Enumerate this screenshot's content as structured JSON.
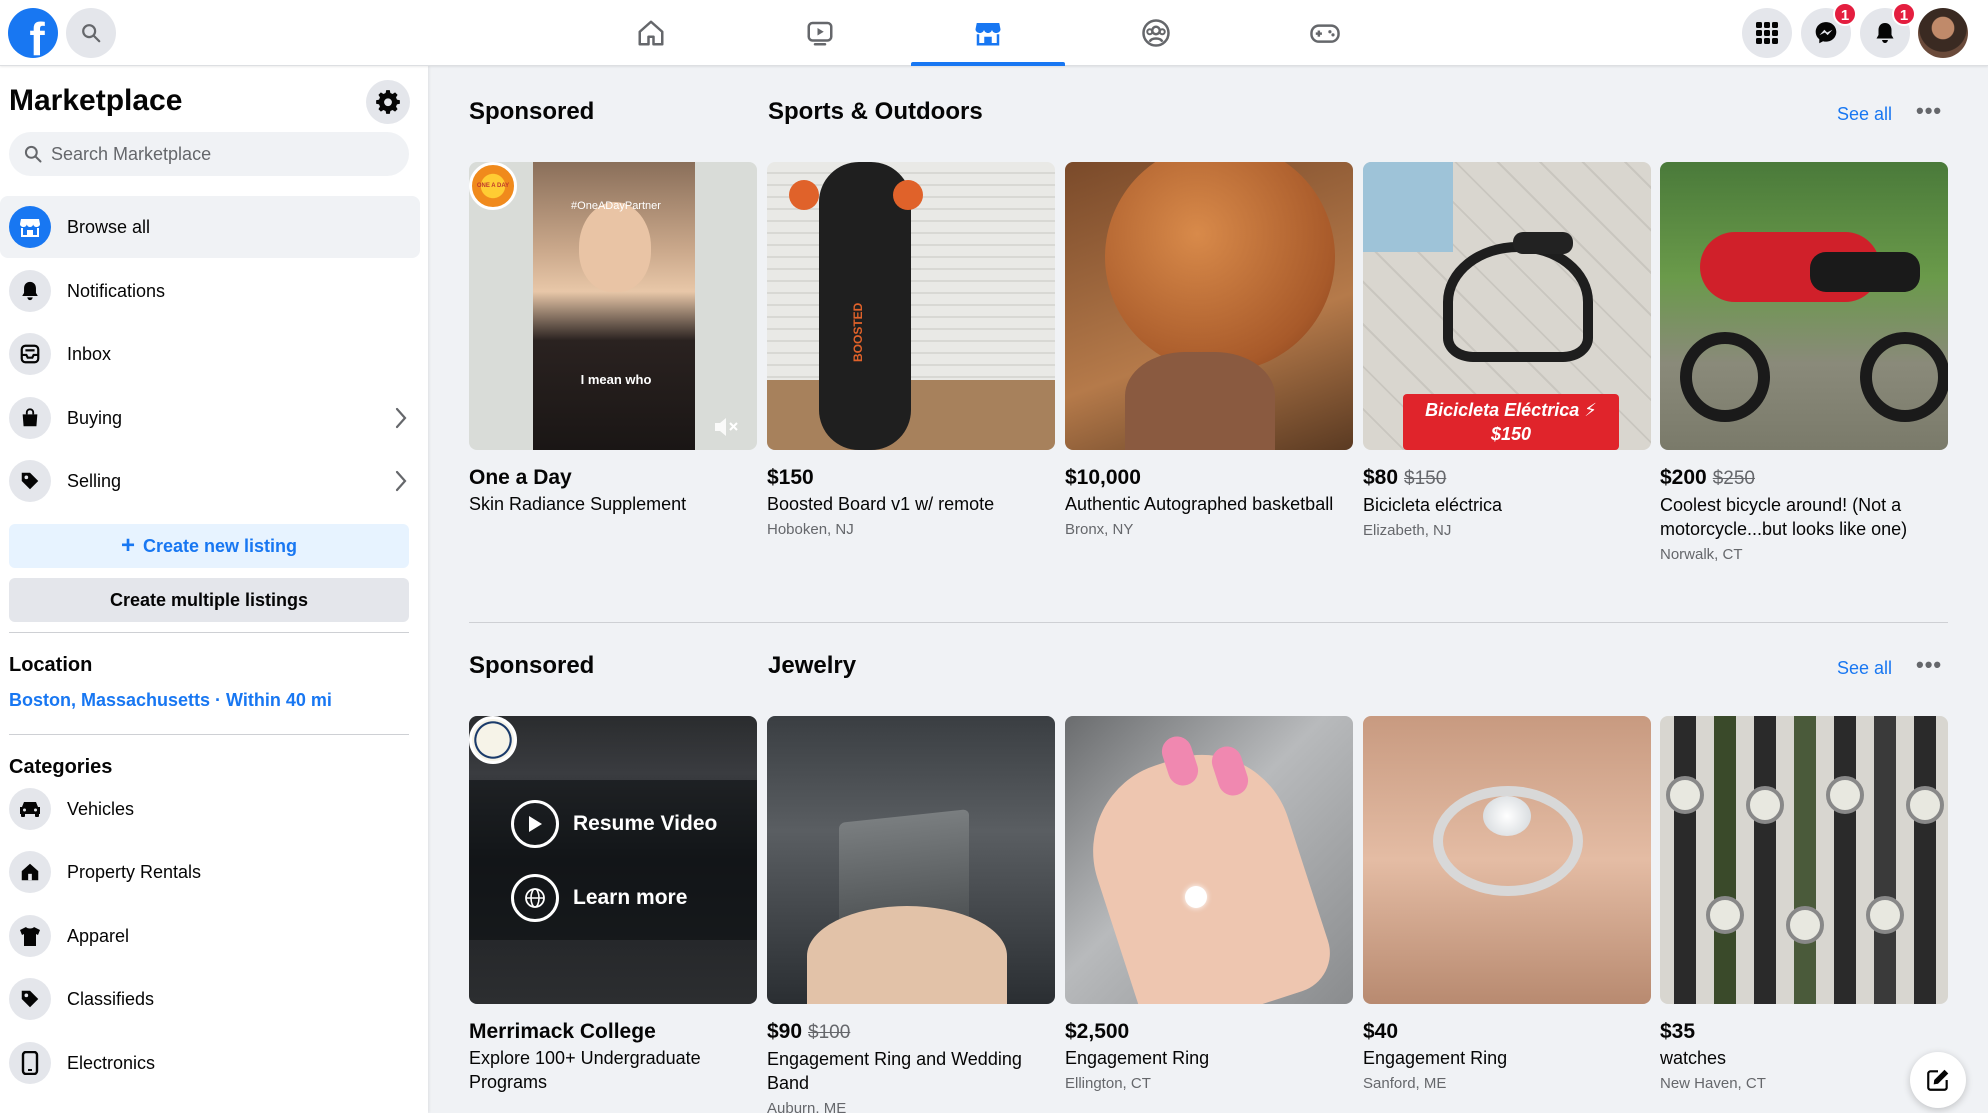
{
  "topbar": {
    "logo_letter": "f",
    "messenger_badge": "1",
    "notifications_badge": "1"
  },
  "sidebar": {
    "title": "Marketplace",
    "search_placeholder": "Search Marketplace",
    "nav": [
      {
        "label": "Browse all"
      },
      {
        "label": "Notifications"
      },
      {
        "label": "Inbox"
      },
      {
        "label": "Buying"
      },
      {
        "label": "Selling"
      }
    ],
    "create_listing": "Create new listing",
    "create_multiple": "Create multiple listings",
    "location_heading": "Location",
    "location_value": "Boston, Massachusetts · Within 40 mi",
    "categories_heading": "Categories",
    "categories": [
      {
        "label": "Vehicles"
      },
      {
        "label": "Property Rentals"
      },
      {
        "label": "Apparel"
      },
      {
        "label": "Classifieds"
      },
      {
        "label": "Electronics"
      }
    ]
  },
  "sections": [
    {
      "sponsored_label": "Sponsored",
      "title": "Sports & Outdoors",
      "see_all": "See all",
      "ad": {
        "title": "One a Day",
        "subtitle": "Skin Radiance Supplement",
        "logo_text": "ONE A DAY",
        "video_caption": "I mean who",
        "video_tag": "#OneADayPartner"
      },
      "listings": [
        {
          "price": "$150",
          "old_price": "",
          "title": "Boosted Board v1 w/ remote",
          "location": "Hoboken, NJ",
          "brand": "BOOSTED"
        },
        {
          "price": "$10,000",
          "old_price": "",
          "title": "Authentic Autographed basketball",
          "location": "Bronx, NY"
        },
        {
          "price": "$80",
          "old_price": "$150",
          "title": "Bicicleta eléctrica",
          "location": "Elizabeth, NJ",
          "tag_line1": "Bicicleta Eléctrica ⚡",
          "tag_line2": "$150"
        },
        {
          "price": "$200",
          "old_price": "$250",
          "title": "Coolest bicycle around! (Not a motorcycle...but looks like one)",
          "location": "Norwalk, CT"
        }
      ]
    },
    {
      "sponsored_label": "Sponsored",
      "title": "Jewelry",
      "see_all": "See all",
      "ad": {
        "title": "Merrimack College",
        "subtitle": "Explore 100+ Undergraduate Programs",
        "resume_label": "Resume Video",
        "learn_label": "Learn more"
      },
      "listings": [
        {
          "price": "$90",
          "old_price": "$100",
          "title": "Engagement Ring and Wedding Band",
          "location": "Auburn, ME"
        },
        {
          "price": "$2,500",
          "old_price": "",
          "title": "Engagement Ring",
          "location": "Ellington, CT"
        },
        {
          "price": "$40",
          "old_price": "",
          "title": "Engagement Ring",
          "location": "Sanford, ME"
        },
        {
          "price": "$35",
          "old_price": "",
          "title": "watches",
          "location": "New Haven, CT"
        }
      ]
    }
  ],
  "colors": {
    "brand": "#1877f2",
    "badge": "#e41e3f",
    "page_bg": "#f0f2f5"
  },
  "icons": [
    "facebook-logo",
    "search-icon",
    "home-icon",
    "watch-icon",
    "marketplace-icon",
    "groups-icon",
    "gaming-icon",
    "menu-grid-icon",
    "messenger-icon",
    "bell-icon",
    "gear-icon",
    "compose-icon"
  ]
}
